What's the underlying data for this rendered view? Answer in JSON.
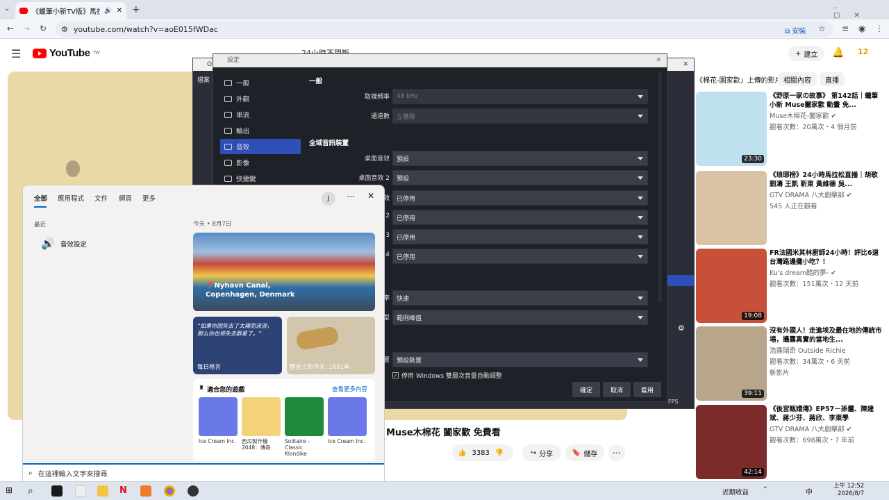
{
  "browser": {
    "tab_title": "《蠟筆小新TV版》馬拉松直",
    "url": "youtube.com/watch?v=aoE015fWDac",
    "install_label": "安裝"
  },
  "youtube": {
    "logo_text": "YouTube",
    "logo_region": "TW",
    "search_value": "24小時不間斷",
    "create_label": "建立",
    "notif_count": "12",
    "chips": [
      "《棉花-園家歡」上傳的影片",
      "相關內容",
      "直播"
    ],
    "video_title": "Muse木棉花 闔家歡 免費看",
    "like_count": "3383",
    "share_label": "分享",
    "save_label": "儲存",
    "side_videos": [
      {
        "title": "《野原一家の故事》 第142話｜蠟筆小新 Muse闔家歡 動畫 免...",
        "channel": "Muse木棉花-闔家歡 ✔",
        "meta": "觀看次數：20萬次・4 個月前",
        "dur": "23:30",
        "color": "#bfe0ef"
      },
      {
        "title": "《琅琊榜》24小時馬拉松直播｜胡歌 劉濤 王凱 靳東 黃維德 吳...",
        "channel": "GTV DRAMA 八大劇樂部 ✔",
        "meta": "545 人正在觀看",
        "dur": "",
        "color": "#d9c3a4"
      },
      {
        "title": "FR法國米其林廚師24小時！評比6道台灣路邊攤小吃？！",
        "channel": "Ku's dream酷的夢- ✔",
        "meta": "觀看次數：151萬次・12 天前",
        "dur": "19:08",
        "color": "#c8503a"
      },
      {
        "title": "沒有外國人！走進埃及最在地的傳統市場，攝露真實的當地生...",
        "channel": "浩露瑞奇 Outside Richie",
        "meta": "觀看次數：34萬次・6 天前",
        "dur": "39:11",
        "badge": "新影片",
        "color": "#b7a58c"
      },
      {
        "title": "《後宮甄嬛傳》EP57－孫儷、陳建斌、蔣少芬、蔣欣、李東學",
        "channel": "GTV DRAMA 八大劇樂部 ✔",
        "meta": "觀看次數：698萬次・7 年前",
        "dur": "42:14",
        "color": "#7c2b2b"
      }
    ]
  },
  "obs": {
    "main_title": "OBS",
    "menu_file": "檔案 (F)",
    "settings_title": "設定",
    "nav": [
      "一般",
      "外觀",
      "串流",
      "輸出",
      "音效",
      "影像",
      "快捷鍵"
    ],
    "selected_nav": "音效",
    "section_general": "一般",
    "sample_rate_label": "取樣頻率",
    "sample_rate_value": "48 kHz",
    "channels_label": "通道數",
    "channels_value": "立體聲",
    "section_global": "全域音訊裝置",
    "desktop_audio_label": "桌面音效",
    "desktop_audio_value": "預設",
    "desktop_audio2_label": "桌面音效 2",
    "desktop_audio2_value": "預設",
    "disabled_rows": [
      {
        "label": "效",
        "value": "已停用"
      },
      {
        "label": "2",
        "value": "已停用"
      },
      {
        "label": "3",
        "value": "已停用"
      },
      {
        "label": "4",
        "value": "已停用"
      }
    ],
    "meter_speed_label": "率",
    "meter_speed_value": "快速",
    "peak_label": "型",
    "peak_value": "範例峰值",
    "monitor_label": "置",
    "monitor_value": "預設裝置",
    "ducking_label": "停用 Windows 雙層次音量自動調整",
    "btn_ok": "確定",
    "btn_cancel": "取消",
    "btn_apply": "套用",
    "fps_text": "FPS"
  },
  "win_search": {
    "tabs": [
      "全部",
      "應用程式",
      "文件",
      "網頁",
      "更多"
    ],
    "user_initial": "J",
    "recent_label": "最近",
    "recent_item": "音效設定",
    "today_label": "今天 • 8月7日",
    "hero_place": "Nyhavn Canal, Copenhagen, Denmark",
    "quote_text": "“如果你因失去了太陽而流淚，那么你也将失去群星了。”",
    "quote_label": "每日格言",
    "history_label": "歷史上的今天: 1661年",
    "games_title": "適合您的遊戲",
    "games_more": "查看更多內容",
    "games": [
      {
        "name": "Ice Cream Inc.",
        "color": "#6b78e8"
      },
      {
        "name": "西瓜製作機 2048：傳奇",
        "color": "#f3d27a"
      },
      {
        "name": "Solitaire - Classic Klondike",
        "color": "#1e8a3a"
      },
      {
        "name": "Ice Cream Inc.",
        "color": "#6b78e8"
      }
    ],
    "search_placeholder": "在這裡輸入文字來搜尋"
  },
  "taskbar": {
    "weather": "近期收益",
    "input_method": "中",
    "time": "上午 12:52",
    "date": "2026/8/7"
  },
  "colors": {
    "yt_red": "#ff0000",
    "obs_selected": "#2e4fb8",
    "win_accent": "#0067c0"
  }
}
